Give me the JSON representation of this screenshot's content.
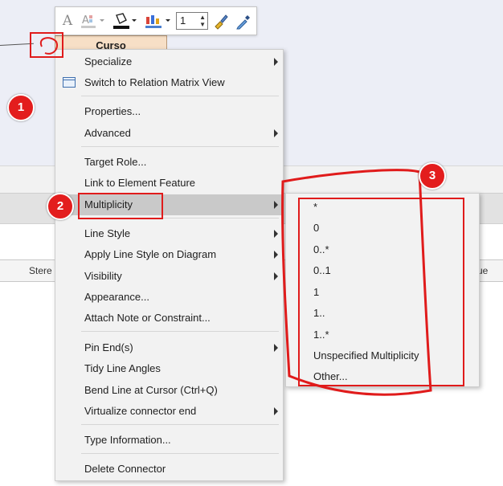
{
  "toolbar": {
    "items": [
      {
        "icon": "font-icon"
      },
      {
        "icon": "text-color-icon"
      },
      {
        "icon": "fill-color-icon"
      },
      {
        "icon": "line-color-icon"
      },
      {
        "icon": "line-width-spinner"
      },
      {
        "icon": "format-painter-icon"
      },
      {
        "icon": "eyedropper-icon"
      }
    ],
    "line_width_value": "1"
  },
  "diagram": {
    "element_name": "Curso",
    "grid_headers": [
      "Stere",
      "ue"
    ]
  },
  "context_menu": {
    "items": [
      {
        "label": "Specialize",
        "submenu": true
      },
      {
        "label": "Switch to Relation Matrix View",
        "submenu": false,
        "icon": "relation-matrix-icon"
      },
      {
        "label": "Properties...",
        "submenu": false
      },
      {
        "label": "Advanced",
        "submenu": true
      },
      {
        "label": "Target Role...",
        "submenu": false
      },
      {
        "label": "Link to Element Feature",
        "submenu": false
      },
      {
        "label": "Multiplicity",
        "submenu": true,
        "selected": true
      },
      {
        "label": "Line Style",
        "submenu": true
      },
      {
        "label": "Apply Line Style on Diagram",
        "submenu": true
      },
      {
        "label": "Visibility",
        "submenu": true
      },
      {
        "label": "Appearance...",
        "submenu": false
      },
      {
        "label": "Attach Note or Constraint...",
        "submenu": false
      },
      {
        "label": "Pin End(s)",
        "submenu": true
      },
      {
        "label": "Tidy Line Angles",
        "submenu": false
      },
      {
        "label": "Bend Line at Cursor (Ctrl+Q)",
        "submenu": false
      },
      {
        "label": "Virtualize connector end",
        "submenu": true
      },
      {
        "label": "Type Information...",
        "submenu": false
      },
      {
        "label": "Delete Connector",
        "submenu": false
      }
    ]
  },
  "multiplicity_submenu": {
    "items": [
      "*",
      "0",
      "0..*",
      "0..1",
      "1",
      "1..",
      "1..*",
      "Unspecified Multiplicity",
      "Other..."
    ]
  },
  "annotations": {
    "badges": [
      "1",
      "2",
      "3"
    ],
    "color": "#e31d1d"
  },
  "colors": {
    "menu_bg": "#f2f2f2",
    "selected_bg": "#c9c9c9",
    "element_fill": "#f7dfc6"
  }
}
